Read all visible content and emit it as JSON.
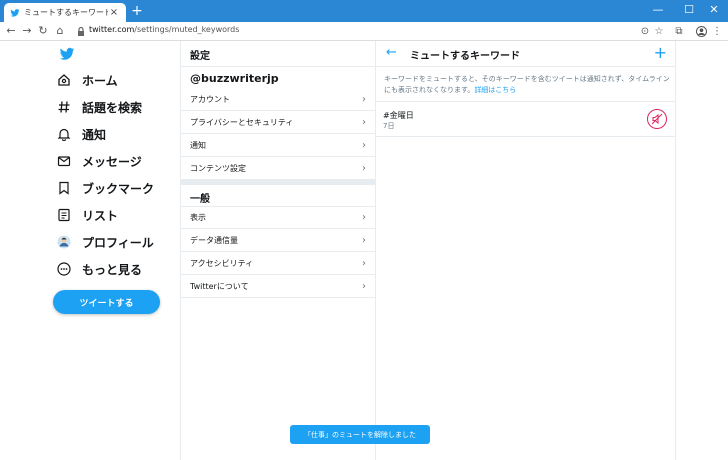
{
  "browser": {
    "tab_title": "ミュートするキーワード / Twitter",
    "tab_close": "×",
    "new_tab": "+",
    "window_buttons": {
      "minimize": "—",
      "maximize": "☐",
      "close": "✕"
    },
    "nav": {
      "back": "←",
      "forward": "→",
      "reload": "↻",
      "home": "⌂"
    },
    "url_host": "twitter.com",
    "url_path": "/settings/muted_keywords",
    "toolbar_icons": [
      "cast-icon",
      "star-icon",
      "extension-icon",
      "profile-icon",
      "menu-icon"
    ]
  },
  "sidebar": {
    "items": [
      {
        "label": "ホーム",
        "icon": "home-icon"
      },
      {
        "label": "話題を検索",
        "icon": "hashtag-icon"
      },
      {
        "label": "通知",
        "icon": "bell-icon"
      },
      {
        "label": "メッセージ",
        "icon": "mail-icon"
      },
      {
        "label": "ブックマーク",
        "icon": "bookmark-icon"
      },
      {
        "label": "リスト",
        "icon": "list-icon"
      },
      {
        "label": "プロフィール",
        "icon": "avatar-icon"
      },
      {
        "label": "もっと見る",
        "icon": "more-icon"
      }
    ],
    "tweet_button": "ツイートする"
  },
  "settings": {
    "title": "設定",
    "username": "@buzzwriterjp",
    "account_rows": [
      "アカウント",
      "プライバシーとセキュリティ",
      "通知",
      "コンテンツ設定"
    ],
    "general_title": "一般",
    "general_rows": [
      "表示",
      "データ通信量",
      "アクセシビリティ",
      "Twitterについて"
    ]
  },
  "detail": {
    "back": "←",
    "title": "ミュートするキーワード",
    "add": "+",
    "description": "キーワードをミュートすると、そのキーワードを含むツイートは通知されず、タイムラインにも表示されなくなります。",
    "learn_more": "詳細はこちら",
    "keyword": "#金曜日",
    "keyword_duration": "7日"
  },
  "toast": "「仕事」のミュートを解除しました",
  "colors": {
    "twitter_blue": "#1da1f2",
    "chrome_blue": "#2b87d3",
    "unmute_red": "#e0245e"
  }
}
